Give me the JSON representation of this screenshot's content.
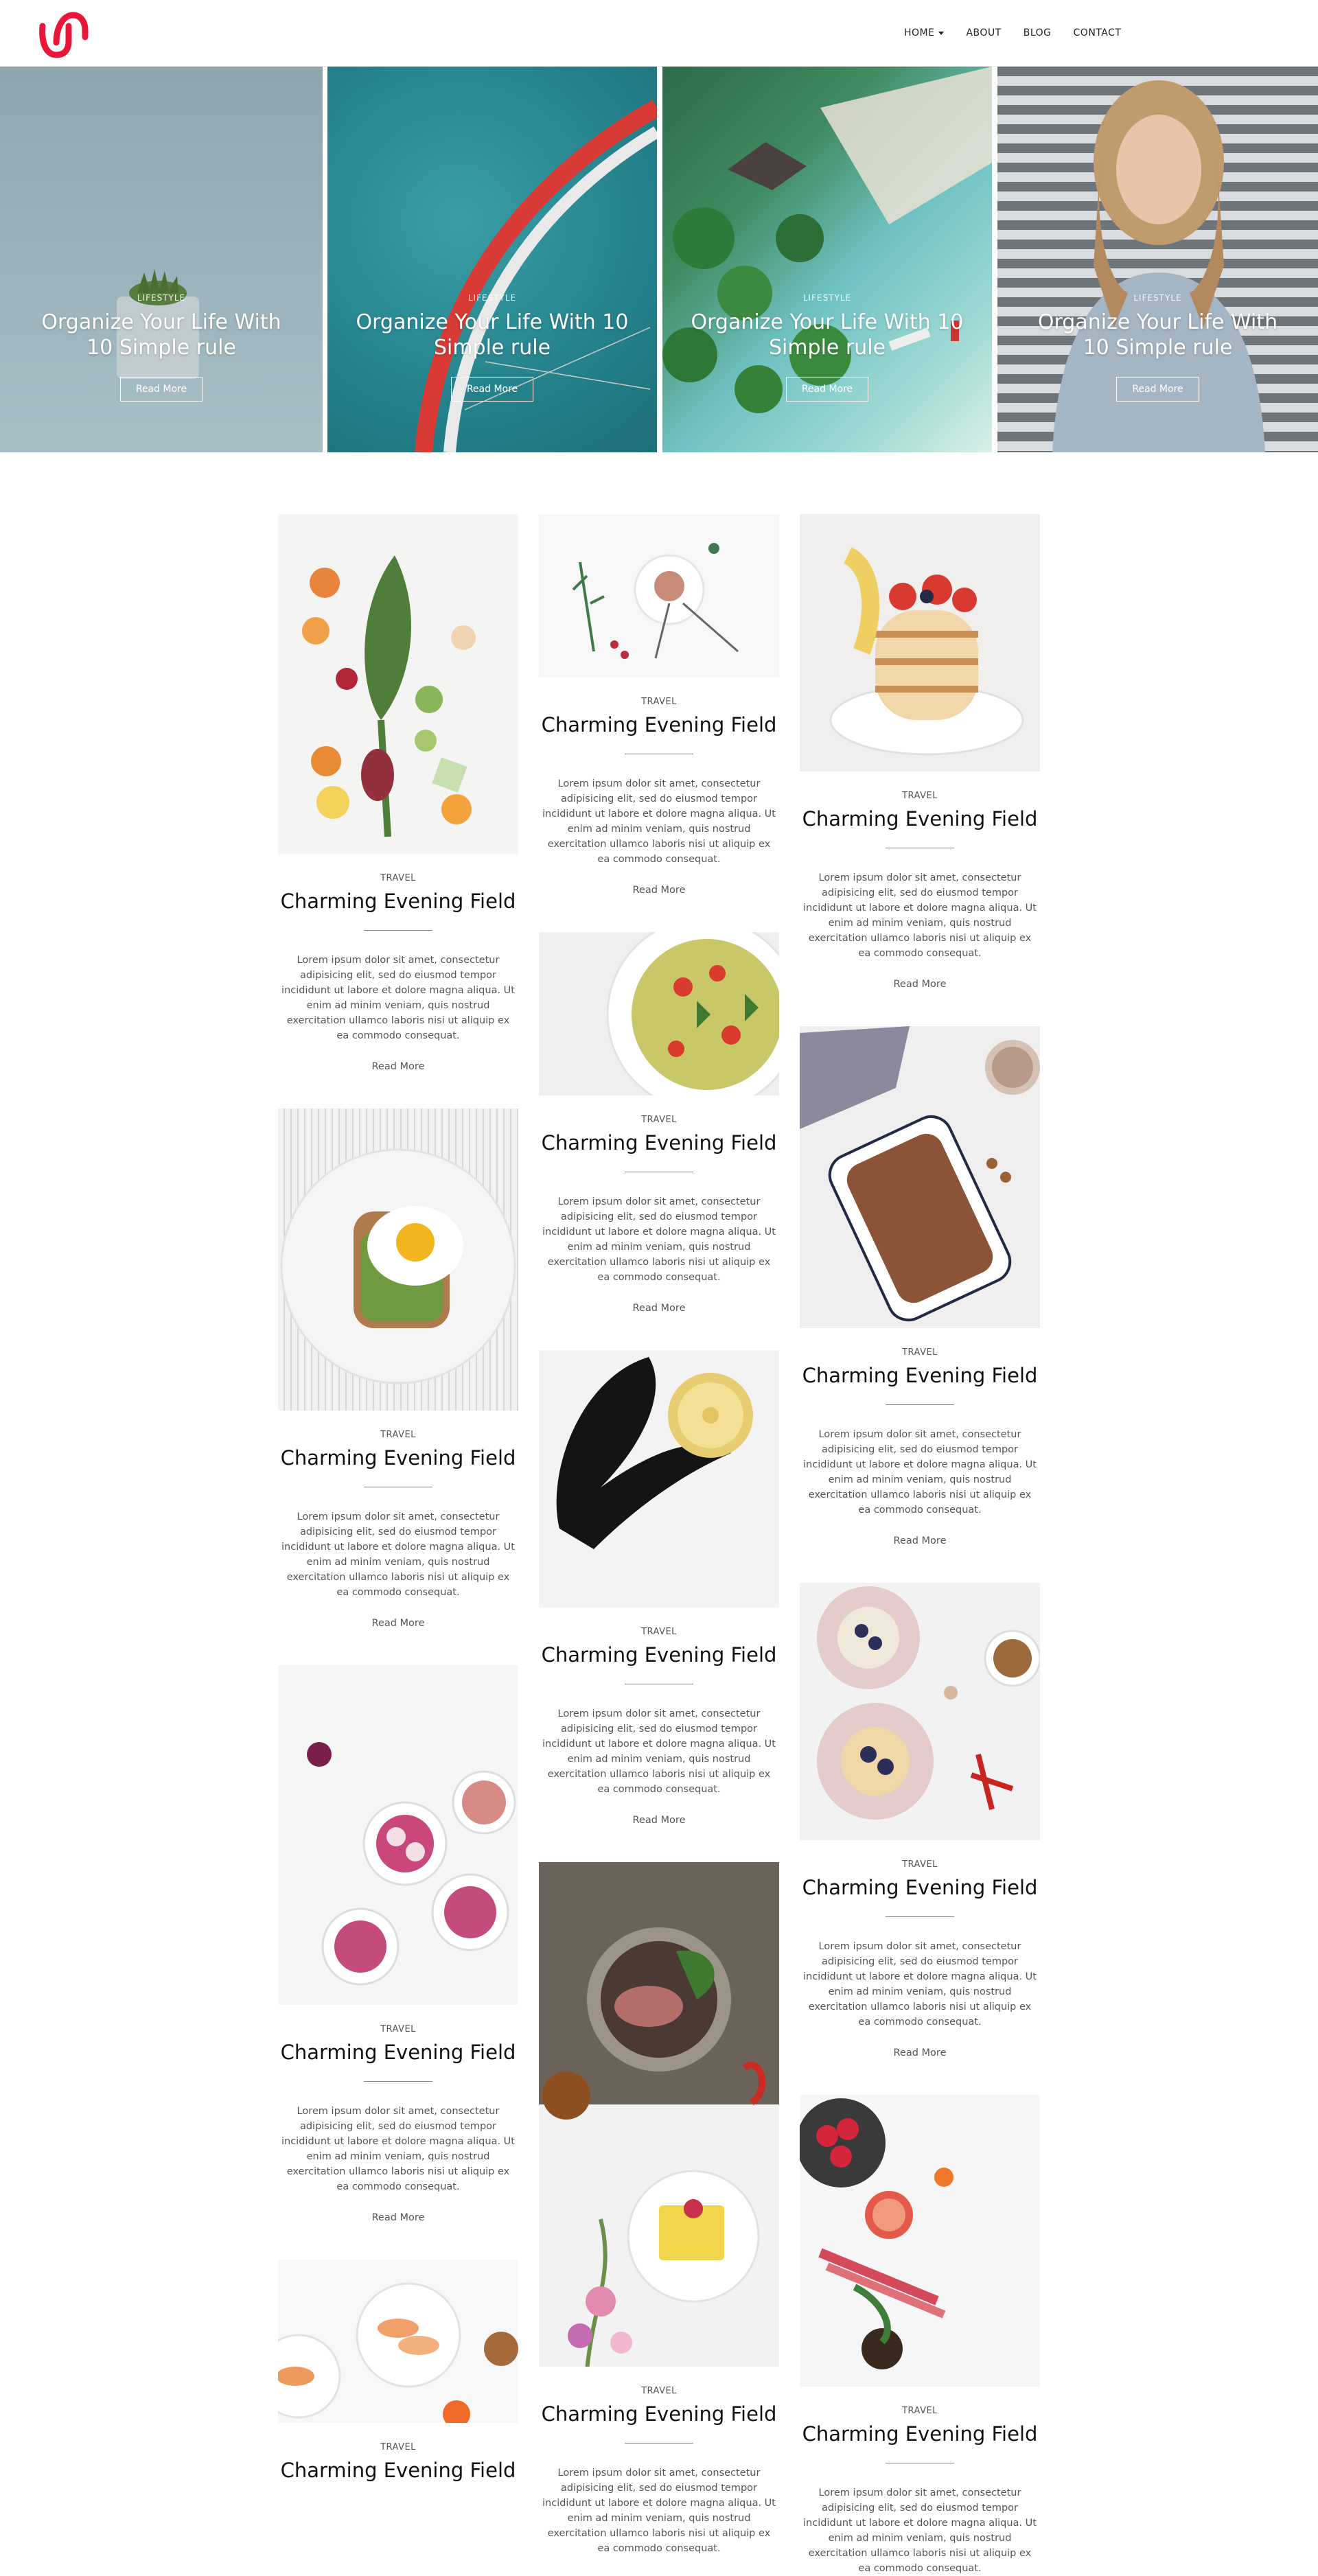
{
  "header": {
    "logo_alt": "logo",
    "nav": [
      "HOME",
      "ABOUT",
      "BLOG",
      "CONTACT"
    ],
    "brand_color": "#e8173a"
  },
  "slides": [
    {
      "category": "LIFESTYLE",
      "title": "Organize Your Life With 10 Simple rule",
      "button": "Read More"
    },
    {
      "category": "LIFESTYLE",
      "title": "Organize Your Life With 10 Simple rule",
      "button": "Read More"
    },
    {
      "category": "LIFESTYLE",
      "title": "Organize Your Life With 10 Simple rule",
      "button": "Read More"
    },
    {
      "category": "LIFESTYLE",
      "title": "Organize Your Life With 10 Simple rule",
      "button": "Read More"
    }
  ],
  "posts": {
    "category": "TRAVEL",
    "title": "Charming Evening Field",
    "excerpt": "Lorem ipsum dolor sit amet, consectetur adipisicing elit, sed do eiusmod tempor incididunt ut labore et dolore magna aliqua. Ut enim ad minim veniam, quis nostrud exercitation ullamco laboris nisi ut aliquip ex ea commodo consequat.",
    "read_more": "Read More"
  },
  "columns": [
    [
      "vegetables-icon",
      "egg-toast-icon",
      "radish-bowls-icon",
      "fruit-bowl-icon"
    ],
    [
      "dessert-plate-icon",
      "pasta-salad-icon",
      "pineapple-feathers-icon",
      "steak-plate-icon"
    ],
    [
      "pancakes-icon",
      "granola-dish-icon",
      "berry-pancakes-icon",
      "fruit-table-icon"
    ]
  ]
}
